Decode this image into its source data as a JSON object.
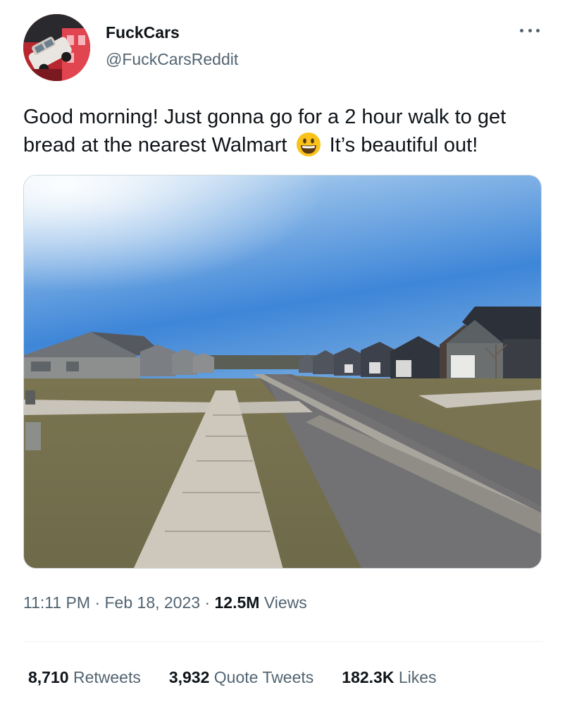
{
  "author": {
    "display_name": "FuckCars",
    "handle": "@FuckCarsReddit",
    "avatar_icon": "avatar-crashed-car-icon"
  },
  "more_icon": "more-dots-icon",
  "tweet": {
    "text_part1": "Good morning! Just gonna go for a 2 hour walk to get bread at the nearest Walmart",
    "emoji": "😃",
    "text_part2": "It’s beautiful out!"
  },
  "media": {
    "icon": "suburban-street-photo"
  },
  "meta": {
    "time": "11:11 PM",
    "separator1": "·",
    "date": "Feb 18, 2023",
    "separator2": "·",
    "views_count": "12.5M",
    "views_label": "Views"
  },
  "stats": {
    "retweets_count": "8,710",
    "retweets_label": "Retweets",
    "quotes_count": "3,932",
    "quotes_label": "Quote Tweets",
    "likes_count": "182.3K",
    "likes_label": "Likes"
  },
  "colors": {
    "text_primary": "#0f1419",
    "text_secondary": "#536471",
    "border": "#cfd9de"
  }
}
